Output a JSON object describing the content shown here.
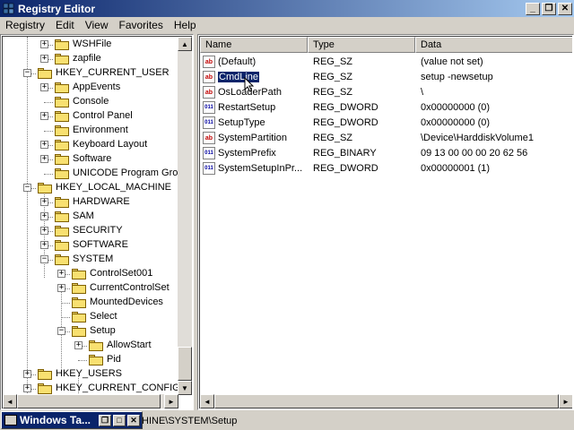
{
  "window": {
    "title": "Registry Editor"
  },
  "title_buttons": {
    "minimize": "_",
    "restore": "❐",
    "close": "✕"
  },
  "menu": [
    "Registry",
    "Edit",
    "View",
    "Favorites",
    "Help"
  ],
  "tree": [
    {
      "label": "WSHFile",
      "expander": "+"
    },
    {
      "label": "zapfile",
      "expander": "+"
    },
    {
      "label": "HKEY_CURRENT_USER",
      "expander": "−"
    },
    {
      "label": "AppEvents",
      "expander": "+"
    },
    {
      "label": "Console",
      "expander": ""
    },
    {
      "label": "Control Panel",
      "expander": "+"
    },
    {
      "label": "Environment",
      "expander": ""
    },
    {
      "label": "Keyboard Layout",
      "expander": "+"
    },
    {
      "label": "Software",
      "expander": "+"
    },
    {
      "label": "UNICODE Program Group",
      "expander": ""
    },
    {
      "label": "HKEY_LOCAL_MACHINE",
      "expander": "−"
    },
    {
      "label": "HARDWARE",
      "expander": "+"
    },
    {
      "label": "SAM",
      "expander": "+"
    },
    {
      "label": "SECURITY",
      "expander": "+"
    },
    {
      "label": "SOFTWARE",
      "expander": "+"
    },
    {
      "label": "SYSTEM",
      "expander": "−"
    },
    {
      "label": "ControlSet001",
      "expander": "+"
    },
    {
      "label": "CurrentControlSet",
      "expander": "+"
    },
    {
      "label": "MountedDevices",
      "expander": ""
    },
    {
      "label": "Select",
      "expander": ""
    },
    {
      "label": "Setup",
      "expander": "−"
    },
    {
      "label": "AllowStart",
      "expander": "+"
    },
    {
      "label": "Pid",
      "expander": ""
    },
    {
      "label": "HKEY_USERS",
      "expander": "+"
    },
    {
      "label": "HKEY_CURRENT_CONFIG",
      "expander": "+"
    }
  ],
  "columns": {
    "name": "Name",
    "type": "Type",
    "data": "Data"
  },
  "values": [
    {
      "icon": "ab",
      "name": "(Default)",
      "type": "REG_SZ",
      "data": "(value not set)"
    },
    {
      "icon": "ab",
      "name": "CmdLine",
      "type": "REG_SZ",
      "data": "setup -newsetup",
      "selected": true
    },
    {
      "icon": "ab",
      "name": "OsLoaderPath",
      "type": "REG_SZ",
      "data": "\\"
    },
    {
      "icon": "011",
      "name": "RestartSetup",
      "type": "REG_DWORD",
      "data": "0x00000000 (0)"
    },
    {
      "icon": "011",
      "name": "SetupType",
      "type": "REG_DWORD",
      "data": "0x00000000 (0)"
    },
    {
      "icon": "ab",
      "name": "SystemPartition",
      "type": "REG_SZ",
      "data": "\\Device\\HarddiskVolume1"
    },
    {
      "icon": "011",
      "name": "SystemPrefix",
      "type": "REG_BINARY",
      "data": "09 13 00 00 00 20 62 56"
    },
    {
      "icon": "011",
      "name": "SystemSetupInPr...",
      "type": "REG_DWORD",
      "data": "0x00000001 (1)"
    }
  ],
  "scroll": {
    "left": "◄",
    "right": "►",
    "up": "▲",
    "down": "▼"
  },
  "status": {
    "path": "HINE\\SYSTEM\\Setup"
  },
  "minimized_window": {
    "title": "Windows Ta...",
    "restore": "❐",
    "maximize": "□",
    "close": "✕"
  }
}
